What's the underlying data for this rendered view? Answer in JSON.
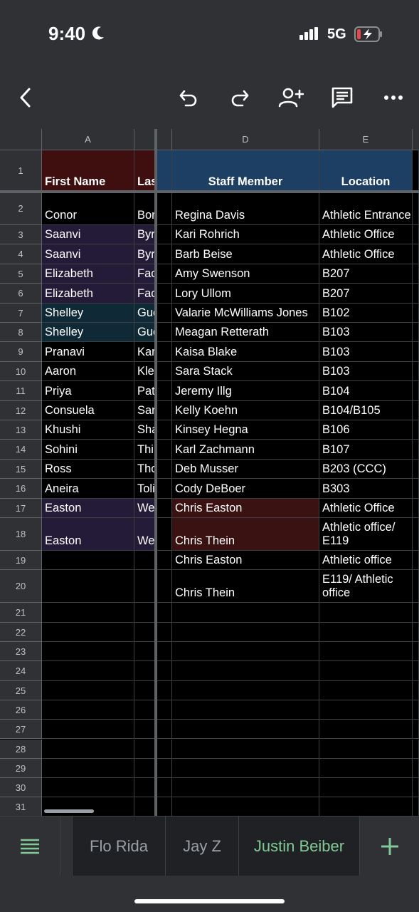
{
  "status_bar": {
    "time": "9:40",
    "network": "5G"
  },
  "toolbar": {
    "back_icon": "chevron-left-icon",
    "undo_icon": "undo-icon",
    "redo_icon": "redo-icon",
    "share_icon": "add-person-icon",
    "comment_icon": "comment-icon",
    "more_icon": "more-horizontal-icon"
  },
  "columns": [
    "A",
    "",
    "",
    "D",
    "E"
  ],
  "header": {
    "row_num": "1",
    "first_name": "First Name",
    "last_name": "Lasts",
    "staff_member": "Staff Member",
    "location": "Location"
  },
  "rows": [
    {
      "num": "2",
      "first": "Conor",
      "last": "Bor",
      "staff": "Regina Davis",
      "loc": "Athletic Entrance"
    },
    {
      "num": "3",
      "first": "Saanvi",
      "last": "Byr",
      "staff": "Kari Rohrich",
      "loc": "Athletic Office"
    },
    {
      "num": "4",
      "first": "Saanvi",
      "last": "Byr",
      "staff": "Barb Beise",
      "loc": "Athletic Office"
    },
    {
      "num": "5",
      "first": "Elizabeth",
      "last": "Fac",
      "staff": "Amy Swenson",
      "loc": "B207"
    },
    {
      "num": "6",
      "first": "Elizabeth",
      "last": "Fac",
      "staff": "Lory Ullom",
      "loc": "B207"
    },
    {
      "num": "7",
      "first": "Shelley",
      "last": "Gue",
      "staff": "Valarie McWilliams Jones",
      "loc": "B102"
    },
    {
      "num": "8",
      "first": "Shelley",
      "last": "Gue",
      "staff": "Meagan Retterath",
      "loc": "B103"
    },
    {
      "num": "9",
      "first": "Pranavi",
      "last": "Kar",
      "staff": "Kaisa Blake",
      "loc": "B103"
    },
    {
      "num": "10",
      "first": "Aaron",
      "last": "Kle",
      "staff": "Sara Stack",
      "loc": "B103"
    },
    {
      "num": "11",
      "first": "Priya",
      "last": "Pat",
      "staff": "Jeremy Illg",
      "loc": "B104"
    },
    {
      "num": "12",
      "first": "Consuela",
      "last": "Sar",
      "staff": "Kelly Koehn",
      "loc": "B104/B105"
    },
    {
      "num": "13",
      "first": "Khushi",
      "last": "Sha",
      "staff": "Kinsey Hegna",
      "loc": "B106"
    },
    {
      "num": "14",
      "first": "Sohini",
      "last": "Thi",
      "staff": "Karl Zachmann",
      "loc": "B107"
    },
    {
      "num": "15",
      "first": "Ross",
      "last": "Tho",
      "staff": "Deb Musser",
      "loc": "B203 (CCC)"
    },
    {
      "num": "16",
      "first": "Aneira",
      "last": "Toli",
      "staff": "Cody DeBoer",
      "loc": "B303"
    },
    {
      "num": "17",
      "first": "Easton",
      "last": "We",
      "staff": "Chris Easton",
      "loc": "Athletic Office"
    },
    {
      "num": "18",
      "first": "Easton",
      "last": "We",
      "staff": "Chris Thein",
      "loc": "Athletic office/ E119"
    },
    {
      "num": "19",
      "first": "",
      "last": "",
      "staff": "Chris  Easton",
      "loc": "Athletic office"
    },
    {
      "num": "20",
      "first": "",
      "last": "",
      "staff": "Chris Thein",
      "loc": "E119/ Athletic office"
    }
  ],
  "empty_rows": [
    "21",
    "22",
    "23",
    "24",
    "25",
    "26",
    "27",
    "28",
    "29",
    "30",
    "31"
  ],
  "colors": {
    "first_name_header_bg": "#3f0f10",
    "staff_header_bg": "#1d3f63",
    "purple_row_bg": "#231b38",
    "blue_row_bg": "#0f2a36",
    "red_cell_bg": "#3a1212",
    "active_tab": "#81c995"
  },
  "sheet_tabs": {
    "menu_icon": "list-icon",
    "tabs": [
      "Flo Rida",
      "Jay Z",
      "Justin Beiber"
    ],
    "active": "Justin Beiber",
    "add_icon": "plus-icon"
  }
}
